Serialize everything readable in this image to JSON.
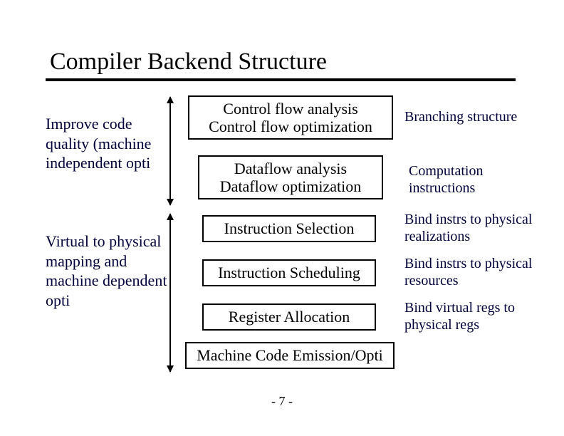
{
  "title": "Compiler Backend Structure",
  "left": {
    "group1": "Improve code quality (machine independent opti",
    "group2": "Virtual to physical mapping and machine dependent opti"
  },
  "boxes": {
    "cfa1": "Control flow analysis",
    "cfa2": "Control flow optimization",
    "dfa1": "Dataflow analysis",
    "dfa2": "Dataflow optimization",
    "isel": "Instruction Selection",
    "isched": "Instruction Scheduling",
    "regalloc": "Register Allocation",
    "mce": "Machine Code Emission/Opti"
  },
  "right": {
    "branching": "Branching structure",
    "computation": "Computation instructions",
    "bind_realizations": "Bind instrs to physical realizations",
    "bind_resources": "Bind instrs to physical resources",
    "bind_regs": "Bind virtual regs to physical regs"
  },
  "page": "- 7 -"
}
